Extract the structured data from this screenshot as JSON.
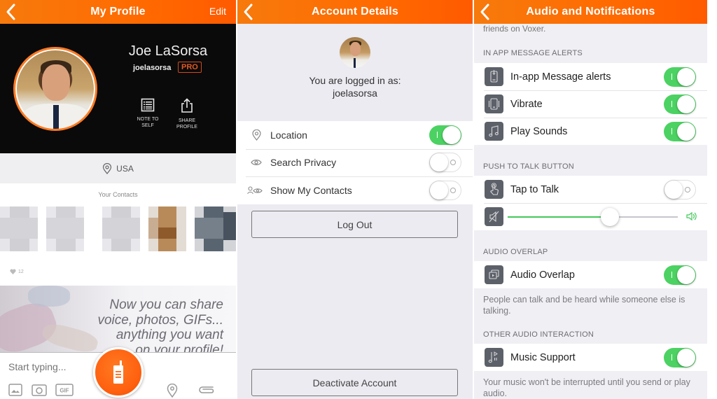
{
  "colors": {
    "brand_orange": "#ff6a00",
    "toggle_on": "#4cd262",
    "pro_badge": "#e35a24"
  },
  "profile": {
    "nav": {
      "title": "My Profile",
      "back_icon": "chevron-left-icon",
      "edit_label": "Edit"
    },
    "name": "Joe LaSorsa",
    "username": "joelasorsa",
    "badge": "PRO",
    "actions": [
      {
        "label": "NOTE TO SELF",
        "line1": "NOTE TO",
        "line2": "SELF",
        "icon": "note-list-icon"
      },
      {
        "label": "SHARE PROFILE",
        "line1": "SHARE",
        "line2": "PROFILE",
        "icon": "share-icon"
      }
    ],
    "location": "USA",
    "contacts_title": "Your Contacts",
    "likes_count": "12",
    "promo_lines": [
      "Now you can share",
      "voice, photos, GIFs...",
      "anything you want",
      "on your profile!"
    ],
    "composer": {
      "placeholder": "Start typing...",
      "tools": [
        "image-icon",
        "camera-icon",
        "gif-icon",
        "location-pin-icon",
        "paperclip-icon"
      ],
      "gif_label": "GIF"
    }
  },
  "account": {
    "nav": {
      "title": "Account Details",
      "back_icon": "chevron-left-icon"
    },
    "logged_in_label": "You are logged in as:",
    "username": "joelasorsa",
    "settings": [
      {
        "label": "Location",
        "icon": "location-pin-icon",
        "on": true
      },
      {
        "label": "Search Privacy",
        "icon": "eye-icon",
        "on": false
      },
      {
        "label": "Show My Contacts",
        "icon": "contacts-eye-icon",
        "on": false
      }
    ],
    "logout_label": "Log Out",
    "deactivate_label": "Deactivate Account"
  },
  "audio": {
    "nav": {
      "title": "Audio and Notifications",
      "back_icon": "chevron-left-icon"
    },
    "top_note": "friends on Voxer.",
    "sections": [
      {
        "header": "IN APP MESSAGE ALERTS",
        "rows": [
          {
            "label": "In-app Message alerts",
            "icon": "phone-alert-icon",
            "on": true
          },
          {
            "label": "Vibrate",
            "icon": "vibrate-icon",
            "on": true
          },
          {
            "label": "Play Sounds",
            "icon": "music-note-icon",
            "on": true
          }
        ]
      },
      {
        "header": "PUSH TO TALK BUTTON",
        "rows": [
          {
            "label": "Tap to Talk",
            "icon": "tap-hand-icon",
            "on": false
          }
        ],
        "volume_slider": {
          "value_percent": 60,
          "mute_icon": "volume-mute-icon",
          "max_icon": "volume-high-icon"
        }
      },
      {
        "header": "AUDIO OVERLAP",
        "rows": [
          {
            "label": "Audio Overlap",
            "icon": "audio-overlap-icon",
            "on": true
          }
        ],
        "footer": "People can talk and be heard while someone else is talking."
      },
      {
        "header": "OTHER AUDIO INTERACTION",
        "rows": [
          {
            "label": "Music Support",
            "icon": "music-play-icon",
            "on": true
          }
        ],
        "footer": "Your music won't be interrupted until you send or play audio."
      }
    ]
  }
}
